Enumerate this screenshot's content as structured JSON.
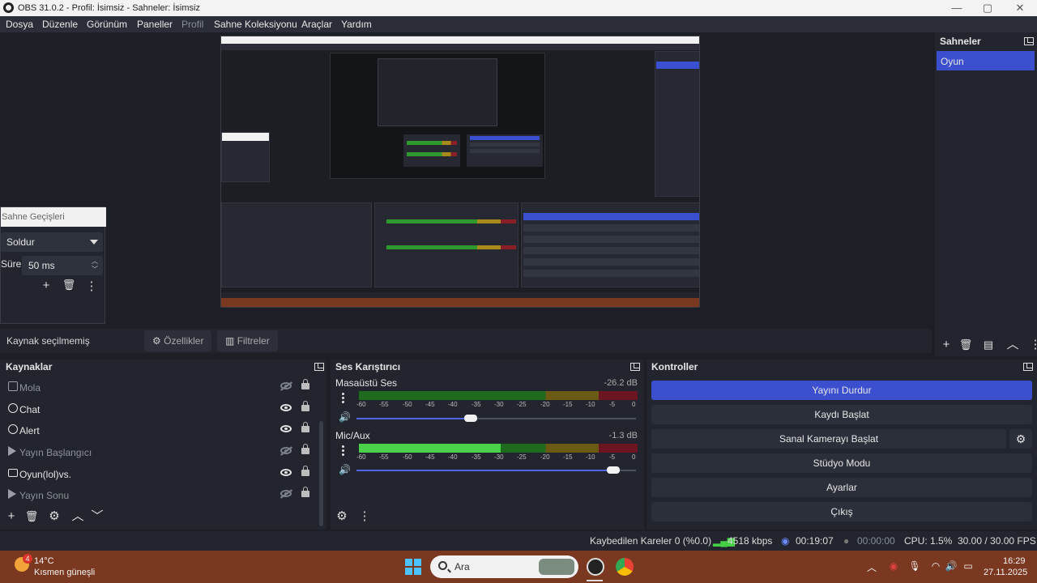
{
  "window": {
    "title": "OBS 31.0.2 - Profil: İsimsiz - Sahneler: İsimsiz"
  },
  "menu": [
    {
      "label": "Dosya"
    },
    {
      "label": "Düzenle"
    },
    {
      "label": "Görünüm"
    },
    {
      "label": "Paneller"
    },
    {
      "label": "Profil"
    },
    {
      "label": "Sahne Koleksiyonu"
    },
    {
      "label": "Araçlar"
    },
    {
      "label": "Yardım"
    }
  ],
  "transitions": {
    "title": "Sahne Geçişleri",
    "type": "Soldur",
    "duration_label": "Süre",
    "duration": "50 ms"
  },
  "scenes": {
    "title": "Sahneler",
    "items": [
      {
        "label": "Oyun",
        "selected": true
      }
    ]
  },
  "source_toolbar": {
    "no_source": "Kaynak seçilmemiş",
    "properties": "Özellikler",
    "filters": "Filtreler"
  },
  "sources": {
    "title": "Kaynaklar",
    "items": [
      {
        "label": "Mola",
        "icon": "image-icon",
        "visible": false
      },
      {
        "label": "Chat",
        "icon": "browser-icon",
        "visible": true
      },
      {
        "label": "Alert",
        "icon": "browser-icon",
        "visible": true
      },
      {
        "label": "Yayın Başlangıcı",
        "icon": "media-icon",
        "visible": false
      },
      {
        "label": "Oyun(lol)vs.",
        "icon": "display-capture-icon",
        "visible": true
      },
      {
        "label": "Yayın Sonu",
        "icon": "media-icon",
        "visible": false
      }
    ]
  },
  "mixer": {
    "title": "Ses Karıştırıcı",
    "channels": [
      {
        "name": "Masaüstü Ses",
        "db": "-26.2 dB",
        "level": 0,
        "volume": 0.41
      },
      {
        "name": "Mic/Aux",
        "db": "-1.3 dB",
        "level": 0.51,
        "volume": 0.92
      }
    ],
    "scale": [
      "-60",
      "-55",
      "-50",
      "-45",
      "-40",
      "-35",
      "-30",
      "-25",
      "-20",
      "-15",
      "-10",
      "-5",
      "0"
    ]
  },
  "controls": {
    "title": "Kontroller",
    "buttons": [
      {
        "label": "Yayını Durdur",
        "active": true
      },
      {
        "label": "Kaydı Başlat"
      },
      {
        "label": "Sanal Kamerayı Başlat"
      },
      {
        "label": "Stüdyo Modu"
      },
      {
        "label": "Ayarlar"
      },
      {
        "label": "Çıkış"
      }
    ]
  },
  "status": {
    "dropped": "Kaybedilen Kareler 0 (%0.0)",
    "bitrate": "4518 kbps",
    "stream_time": "00:19:07",
    "rec_time": "00:00:00",
    "cpu": "CPU: 1.5%",
    "fps": "30.00 / 30.00 FPS"
  },
  "taskbar": {
    "weather_temp": "14°C",
    "weather_desc": "Kısmen güneşli",
    "weather_badge": "4",
    "search": "Ara",
    "time": "16:29",
    "date": "27.11.2025"
  },
  "colors": {
    "accent": "#3c4fcf",
    "taskbar": "#7a3820",
    "dock_bg": "#22252d"
  }
}
